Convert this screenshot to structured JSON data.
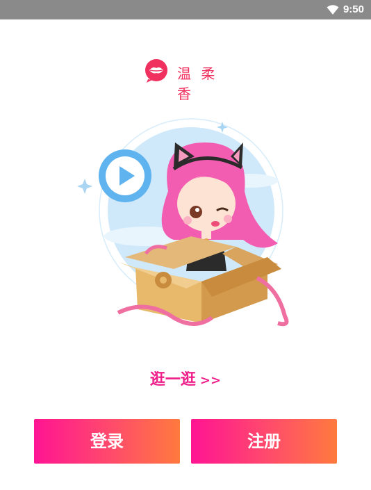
{
  "status_bar": {
    "time": "9:50",
    "wifi_icon": "wifi-icon"
  },
  "brand": {
    "logo_icon": "lips-logo-icon",
    "name": "温 柔 香"
  },
  "hero": {
    "illustration": "girl-in-box-illustration",
    "play_icon": "play-icon"
  },
  "browse": {
    "label": "逛一逛",
    "arrows": ">>"
  },
  "buttons": {
    "login": "登录",
    "register": "注册"
  },
  "colors": {
    "brand_pink": "#f0305e",
    "link_magenta": "#ee1f8a",
    "gradient_start": "#ff1493",
    "gradient_end": "#ff7a3d"
  }
}
